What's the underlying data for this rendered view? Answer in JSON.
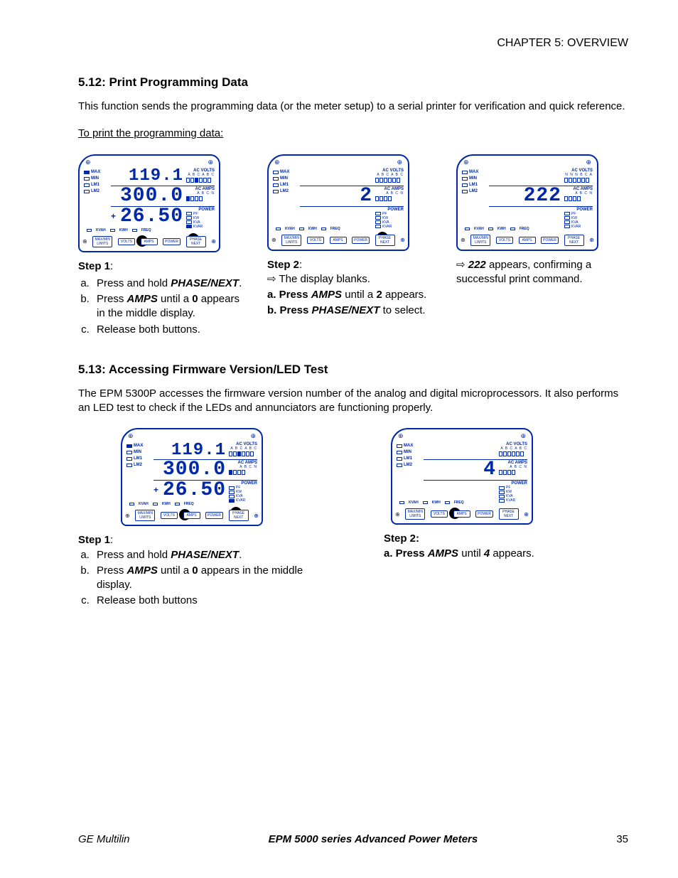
{
  "chapter": "CHAPTER 5: OVERVIEW",
  "sec1": {
    "title": "5.12: Print Programming Data",
    "intro": "This function sends the programming data (or the meter setup) to a serial printer for verification and quick reference.",
    "subhead": "To print the programming data:"
  },
  "meter_labels": {
    "max": "MAX",
    "min": "MIN",
    "lm1": "LM1",
    "lm2": "LM2",
    "acvolts": "AC VOLTS",
    "acamps": "AC AMPS",
    "power": "POWER",
    "abc_abc": "A  B  C  A  B  C",
    "abcn": "A  B  C  N",
    "nnnbca": "N  N  N  B  C  A",
    "pf": "PF",
    "kw": "KW",
    "kva": "KVA",
    "kvar": "KVAR",
    "kvah": "KVAH",
    "kwh": "KWH",
    "freq": "FREQ",
    "maxmin": "MAX/MIN",
    "limits": "LIMITS",
    "volts": "VOLTS",
    "amps": "AMPS",
    "powerbtn": "POWER",
    "phase": "PHASE",
    "next": "NEXT"
  },
  "meters": {
    "m1": {
      "r1": "119.1",
      "r2": "300.0",
      "r3": "26.50",
      "plus": true
    },
    "m2": {
      "r1": "",
      "r2": "2",
      "r3": ""
    },
    "m3": {
      "r1": "",
      "r2": "222",
      "r3": ""
    },
    "m4": {
      "r1": "119.1",
      "r2": "300.0",
      "r3": "26.50",
      "plus": true
    },
    "m5": {
      "r1": "",
      "r2": "4",
      "r3": ""
    }
  },
  "steps1": {
    "s1_label": "Step 1",
    "s1_a_pre": "Press and hold ",
    "s1_a_b": "PHASE/NEXT",
    "s1_a_post": ".",
    "s1_b_pre": "Press ",
    "s1_b_b": "AMPS",
    "s1_b_mid": " until a ",
    "s1_b_num": "0",
    "s1_b_post": " appears in the middle display.",
    "s1_c": "Release both buttons.",
    "s2_label": "Step 2",
    "s2_arrow": "⇨ The display blanks.",
    "s2_a_pre": "a. Press ",
    "s2_a_b": "AMPS",
    "s2_a_mid": " until a ",
    "s2_a_num": "2",
    "s2_a_post": " appears.",
    "s2_b_pre": "b. Press ",
    "s2_b_b": "PHASE/NEXT",
    "s2_b_post": " to select.",
    "s3_pre": "⇨ ",
    "s3_num": "222",
    "s3_post": " appears, confirming a successful print command."
  },
  "sec2": {
    "title": "5.13: Accessing Firmware Version/LED Test",
    "intro": "The EPM 5300P accesses the firmware version number of the analog and digital microprocessors.  It also performs an LED test to check if the LEDs and annunciators are functioning properly."
  },
  "steps2": {
    "s1_label": "Step 1",
    "s1_a_pre": "Press and hold ",
    "s1_a_b": "PHASE/NEXT",
    "s1_a_post": ".",
    "s1_b_pre": "Press ",
    "s1_b_b": "AMPS",
    "s1_b_mid": " until a ",
    "s1_b_num": "0",
    "s1_b_post": " appears in the middle display.",
    "s1_c": "Release both buttons",
    "s2_label": "Step 2:",
    "s2_a_pre": "a. Press ",
    "s2_a_b": "AMPS",
    "s2_a_mid": " until ",
    "s2_a_num": "4",
    "s2_a_post": " appears."
  },
  "footer": {
    "left": "GE Multilin",
    "center": "EPM 5000 series Advanced Power Meters",
    "page": "35"
  }
}
